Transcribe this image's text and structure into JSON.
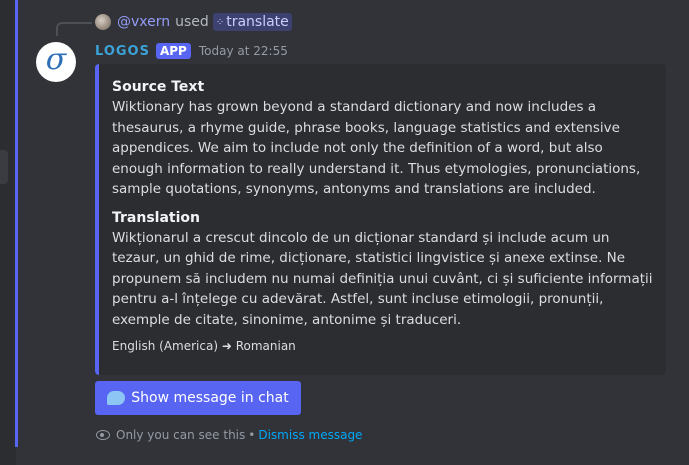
{
  "reply": {
    "username": "@vxern",
    "used_text": "used",
    "command_icon": "slash-command-icon",
    "command_glyph": "⁘",
    "command_name": "translate"
  },
  "message": {
    "bot_name": "LOGOS",
    "badge": "APP",
    "timestamp": "Today at 22:55",
    "avatar_glyph": "σ",
    "avatar_icon": "logos-logo-icon"
  },
  "embed": {
    "accent_color": "#5865f2",
    "source_title": "Source Text",
    "source_text": "Wiktionary has grown beyond a standard dictionary and now includes a thesaurus, a rhyme guide, phrase books, language statistics and extensive appendices. We aim to include not only the definition of a word, but also enough information to really understand it. Thus etymologies, pronunciations, sample quotations, synonyms, antonyms and translations are included.",
    "translation_title": "Translation",
    "translation_text": "Wikționarul a crescut dincolo de un dicționar standard și include acum un tezaur, un ghid de rime, dicționare, statistici lingvistice și anexe extinse. Ne propunem să includem nu numai definiția unui cuvânt, ci și suficiente informații pentru a-l înțelege cu adevărat. Astfel, sunt incluse etimologii, pronunții, exemple de citate, sinonime, antonime și traduceri.",
    "footer": "English (America) ➜ Romanian"
  },
  "button": {
    "label": "Show message in chat",
    "icon": "speech-bubble-icon"
  },
  "ephemeral": {
    "icon": "eye-icon",
    "text": "Only you can see this",
    "separator": "•",
    "dismiss_label": "Dismiss message"
  }
}
